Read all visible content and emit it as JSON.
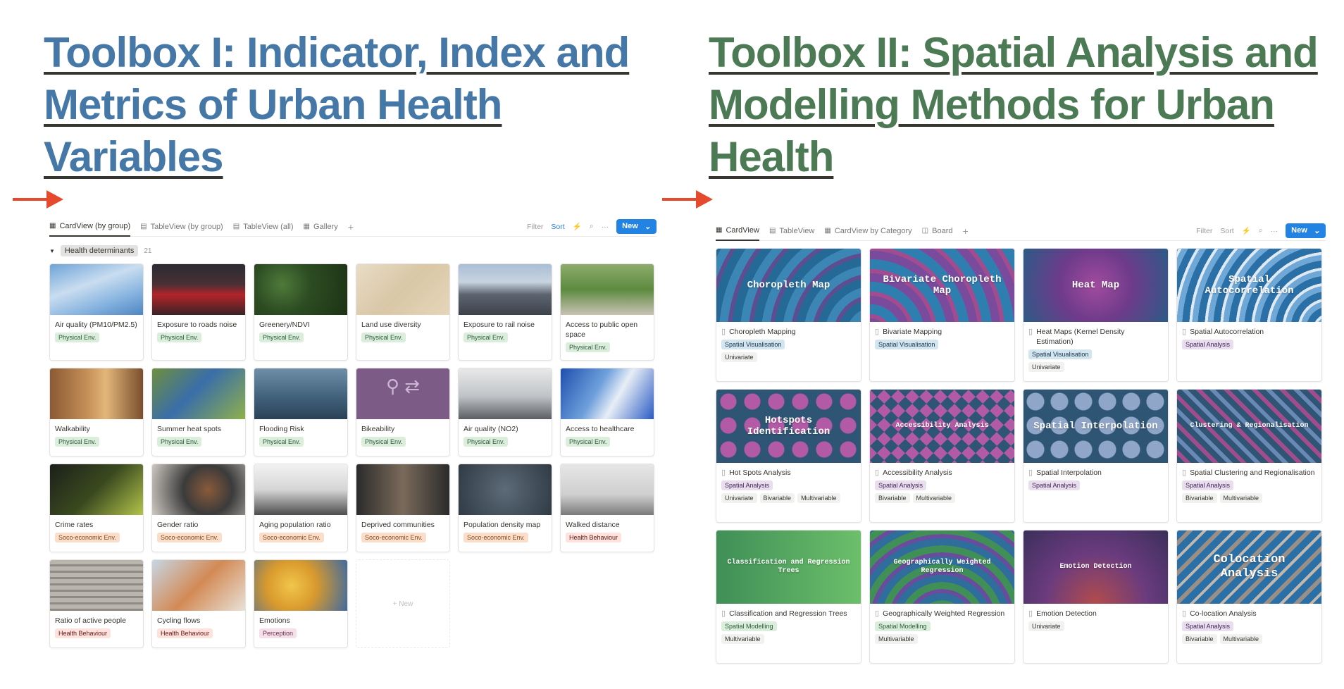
{
  "toolbox1": {
    "title": "Toolbox I: Indicator, Index and Metrics of Urban Health Variables",
    "tabs": [
      "CardView (by group)",
      "TableView (by group)",
      "TableView (all)",
      "Gallery"
    ],
    "toolbar": {
      "filter": "Filter",
      "sort": "Sort",
      "new": "New"
    },
    "group": {
      "name": "Health determinants",
      "count": "21"
    },
    "cards": [
      {
        "name": "Air quality (PM10/PM2.5)",
        "tag": "Physical Env."
      },
      {
        "name": "Exposure to roads noise",
        "tag": "Physical Env."
      },
      {
        "name": "Greenery/NDVI",
        "tag": "Physical Env."
      },
      {
        "name": "Land use diversity",
        "tag": "Physical Env."
      },
      {
        "name": "Exposure to rail noise",
        "tag": "Physical Env."
      },
      {
        "name": "Access to public open space",
        "tag": "Physical Env."
      },
      {
        "name": "Walkability",
        "tag": "Physical Env."
      },
      {
        "name": "Summer heat spots",
        "tag": "Physical Env."
      },
      {
        "name": "Flooding Risk",
        "tag": "Physical Env."
      },
      {
        "name": "Bikeability",
        "tag": "Physical Env."
      },
      {
        "name": "Air quality (NO2)",
        "tag": "Physical Env."
      },
      {
        "name": "Access to healthcare",
        "tag": "Physical Env."
      },
      {
        "name": "Crime rates",
        "tag": "Soco-economic Env."
      },
      {
        "name": "Gender ratio",
        "tag": "Soco-economic Env."
      },
      {
        "name": "Aging population ratio",
        "tag": "Soco-economic Env."
      },
      {
        "name": "Deprived communities",
        "tag": "Soco-economic Env."
      },
      {
        "name": "Population density map",
        "tag": "Soco-economic Env."
      },
      {
        "name": "Walked distance",
        "tag": "Health Behaviour"
      },
      {
        "name": "Ratio of active people",
        "tag": "Health Behaviour"
      },
      {
        "name": "Cycling flows",
        "tag": "Health Behaviour"
      },
      {
        "name": "Emotions",
        "tag": "Perception"
      }
    ],
    "new_card": "+ New"
  },
  "toolbox2": {
    "title": "Toolbox II: Spatial Analysis and Modelling Methods for Urban Health",
    "tabs": [
      "CardView",
      "TableView",
      "CardView by Category",
      "Board"
    ],
    "toolbar": {
      "filter": "Filter",
      "sort": "Sort",
      "new": "New"
    },
    "cards": [
      {
        "cover": "Choropleth Map",
        "name": "Choropleth Mapping",
        "tags": [
          "Spatial Visualisation",
          "Univariate"
        ]
      },
      {
        "cover": "Bivariate Choropleth Map",
        "name": "Bivariate Mapping",
        "tags": [
          "Spatial Visualisation"
        ]
      },
      {
        "cover": "Heat Map",
        "name": "Heat Maps (Kernel Density Estimation)",
        "tags": [
          "Spatial Visualisation",
          "Univariate"
        ]
      },
      {
        "cover": "Spatial Autocorrelation",
        "name": "Spatial Autocorrelation",
        "tags": [
          "Spatial Analysis"
        ]
      },
      {
        "cover": "Hotspots Identification",
        "name": "Hot Spots Analysis",
        "tags": [
          "Spatial Analysis",
          "Univariate",
          "Bivariable",
          "Multivariable"
        ]
      },
      {
        "cover": "Accessibility Analysis",
        "name": "Accessibility Analysis",
        "tags": [
          "Spatial Analysis",
          "Bivariable",
          "Multivariable"
        ]
      },
      {
        "cover": "Spatial Interpolation",
        "name": "Spatial Interpolation",
        "tags": [
          "Spatial Analysis"
        ]
      },
      {
        "cover": "Clustering & Regionalisation",
        "name": "Spatial Clustering and Regionalisation",
        "tags": [
          "Spatial Analysis",
          "Bivariable",
          "Multivariable"
        ]
      },
      {
        "cover": "Classification and Regression Trees",
        "name": "Classification and Regression Trees",
        "tags": [
          "Spatial Modelling",
          "Multivariable"
        ]
      },
      {
        "cover": "Geographically Weighted Regression",
        "name": "Geographically Weighted Regression",
        "tags": [
          "Spatial Modelling",
          "Multivariable"
        ]
      },
      {
        "cover": "Emotion Detection",
        "name": "Emotion Detection",
        "tags": [
          "Univariate"
        ]
      },
      {
        "cover": "Colocation Analysis",
        "name": "Co-location Analysis",
        "tags": [
          "Spatial Analysis",
          "Bivariable",
          "Multivariable"
        ]
      }
    ]
  },
  "colors": {
    "toolbox1_title": "#4678a7",
    "toolbox2_title": "#4b7a54",
    "arrow": "#e64a2e",
    "accent": "#2383e2"
  }
}
